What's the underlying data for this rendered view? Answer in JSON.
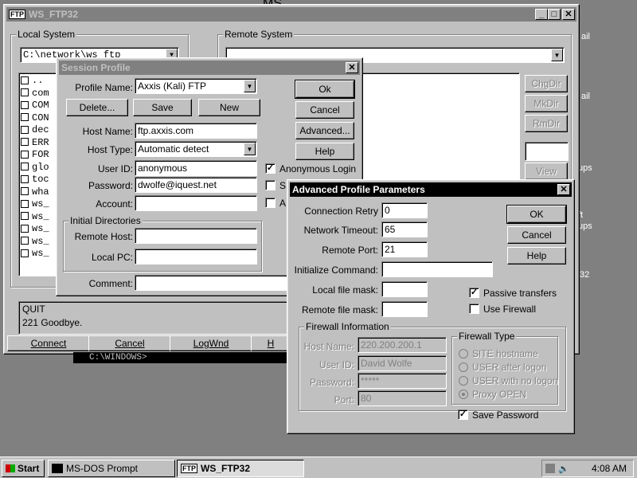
{
  "desktop": {
    "bg_title": "MS",
    "right_labels": [
      "ail",
      "ail",
      "ups",
      "ft",
      "ups",
      "32"
    ]
  },
  "ws_ftp": {
    "title": "WS_FTP32",
    "app_icon": "FTP",
    "local_system_label": "Local System",
    "remote_system_label": "Remote System",
    "local_path": "C:\\network\\ws_ftp",
    "local_files": [
      "..",
      "com",
      "COM",
      "CON",
      "dec",
      "ERR",
      "FOR",
      "glo",
      "toc",
      "wha",
      "ws_",
      "ws_",
      "ws_",
      "ws_",
      "ws_"
    ],
    "remote_buttons": [
      "ChgDir",
      "MkDir",
      "RmDir",
      "View"
    ],
    "log_lines": [
      "QUIT",
      "221 Goodbye."
    ],
    "bottom_buttons": [
      "Connect",
      "Cancel",
      "LogWnd",
      "H"
    ],
    "dos_snippet": "C:\\WINDOWS>"
  },
  "session_profile": {
    "title": "Session Profile",
    "profile_name_label": "Profile Name:",
    "profile_name_value": "Axxis (Kali) FTP",
    "delete_btn": "Delete...",
    "save_btn": "Save",
    "new_btn": "New",
    "host_name_label": "Host Name:",
    "host_name_value": "ftp.axxis.com",
    "host_type_label": "Host Type:",
    "host_type_value": "Automatic detect",
    "user_id_label": "User ID:",
    "user_id_value": "anonymous",
    "password_label": "Password:",
    "password_value": "dwolfe@iquest.net",
    "account_label": "Account:",
    "account_value": "",
    "anon_login_label": "Anonymous Login",
    "save_pwd_label": "S",
    "auto_label": "A",
    "initial_dirs_label": "Initial Directories",
    "remote_host_label": "Remote Host:",
    "local_pc_label": "Local PC:",
    "comment_label": "Comment:",
    "ok_btn": "Ok",
    "cancel_btn": "Cancel",
    "advanced_btn": "Advanced...",
    "help_btn": "Help"
  },
  "advanced": {
    "title": "Advanced Profile Parameters",
    "connection_retry_label": "Connection Retry",
    "connection_retry_value": "0",
    "network_timeout_label": "Network Timeout:",
    "network_timeout_value": "65",
    "remote_port_label": "Remote Port:",
    "remote_port_value": "21",
    "init_command_label": "Initialize Command:",
    "local_mask_label": "Local file mask:",
    "remote_mask_label": "Remote file mask:",
    "passive_label": "Passive transfers",
    "firewall_label": "Use Firewall",
    "fw_info_label": "Firewall Information",
    "fw_host_label": "Host Name:",
    "fw_host_value": "220.200.200.1",
    "fw_user_label": "User ID:",
    "fw_user_value": "David Wolfe",
    "fw_pwd_label": "Password:",
    "fw_pwd_value": "*****",
    "fw_port_label": "Port:",
    "fw_port_value": "80",
    "fw_type_label": "Firewall Type",
    "fw_types": [
      "SITE hostname",
      "USER after logon",
      "USER with no logon",
      "Proxy OPEN"
    ],
    "save_pwd_label": "Save Password",
    "ok_btn": "OK",
    "cancel_btn": "Cancel",
    "help_btn": "Help"
  },
  "taskbar": {
    "start": "Start",
    "task1": "MS-DOS Prompt",
    "task2": "WS_FTP32",
    "clock": "4:08 AM"
  }
}
